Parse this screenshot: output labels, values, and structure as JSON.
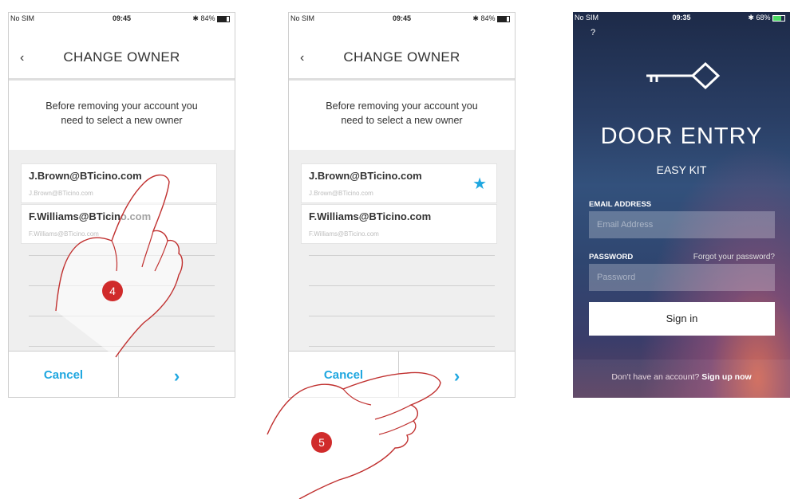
{
  "status_left": "No SIM",
  "phones": [
    {
      "status_time": "09:45",
      "status_battery": "84%",
      "title": "CHANGE OWNER",
      "message_line1": "Before removing your account you",
      "message_line2": "need to select a new owner",
      "accounts": [
        {
          "label": "J.Brown@BTicino.com",
          "sub": "J.Brown@BTicino.com"
        },
        {
          "label": "F.Williams@BTicino.com",
          "sub": "F.Williams@BTicino.com"
        }
      ],
      "cancel_label": "Cancel",
      "next_label": "›",
      "step_badge": "4"
    },
    {
      "status_time": "09:45",
      "status_battery": "84%",
      "title": "CHANGE OWNER",
      "message_line1": "Before removing your account you",
      "message_line2": "need to select a new owner",
      "accounts": [
        {
          "label": "J.Brown@BTicino.com",
          "sub": "J.Brown@BTicino.com",
          "selected": true
        },
        {
          "label": "F.Williams@BTicino.com",
          "sub": "F.Williams@BTicino.com"
        }
      ],
      "cancel_label": "Cancel",
      "next_label": "›",
      "step_badge": "5"
    }
  ],
  "login": {
    "status_time": "09:35",
    "status_battery": "68%",
    "help": "?",
    "title": "DOOR ENTRY",
    "subtitle": "EASY KIT",
    "email_label": "EMAIL ADDRESS",
    "email_placeholder": "Email Address",
    "password_label": "PASSWORD",
    "forgot": "Forgot your password?",
    "password_placeholder": "Password",
    "signin": "Sign in",
    "footer_text": "Don't have an account?",
    "footer_link": "Sign up now"
  },
  "colors": {
    "accent": "#1fa7e0",
    "badge": "#d02b2b",
    "hand_outline": "#c0302f"
  }
}
